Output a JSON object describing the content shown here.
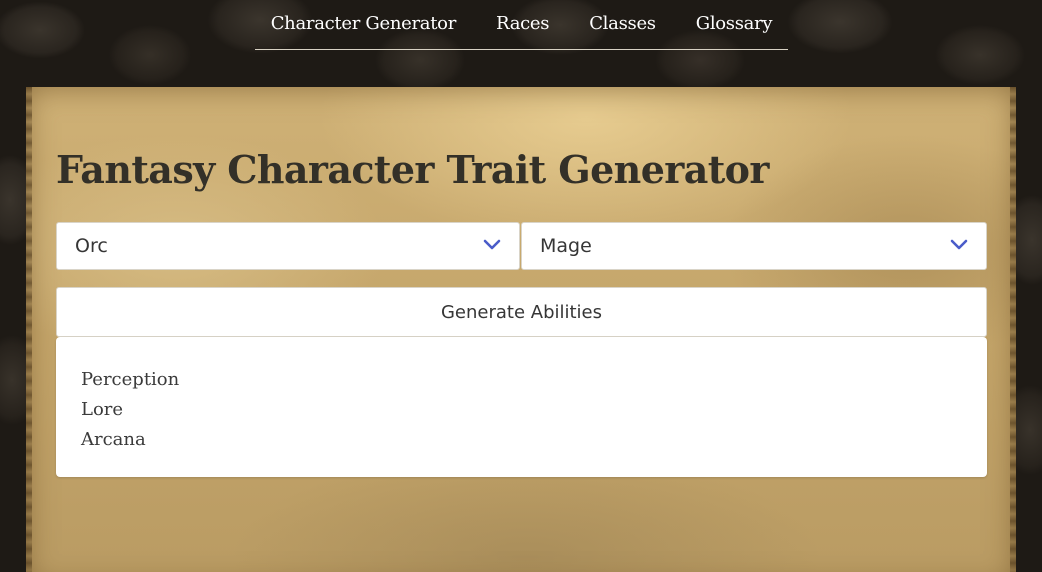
{
  "nav": {
    "items": [
      {
        "label": "Character Generator"
      },
      {
        "label": "Races"
      },
      {
        "label": "Classes"
      },
      {
        "label": "Glossary"
      }
    ]
  },
  "main": {
    "title": "Fantasy Character Trait Generator",
    "race_select": {
      "value": "Orc",
      "icon": "chevron-down-icon"
    },
    "class_select": {
      "value": "Mage",
      "icon": "chevron-down-icon"
    },
    "generate_button": {
      "label": "Generate Abilities"
    },
    "abilities": [
      "Perception",
      "Lore",
      "Arcana"
    ]
  },
  "colors": {
    "accent": "#4a5cc9",
    "title_text": "#333028",
    "nav_text": "#ffffff"
  }
}
